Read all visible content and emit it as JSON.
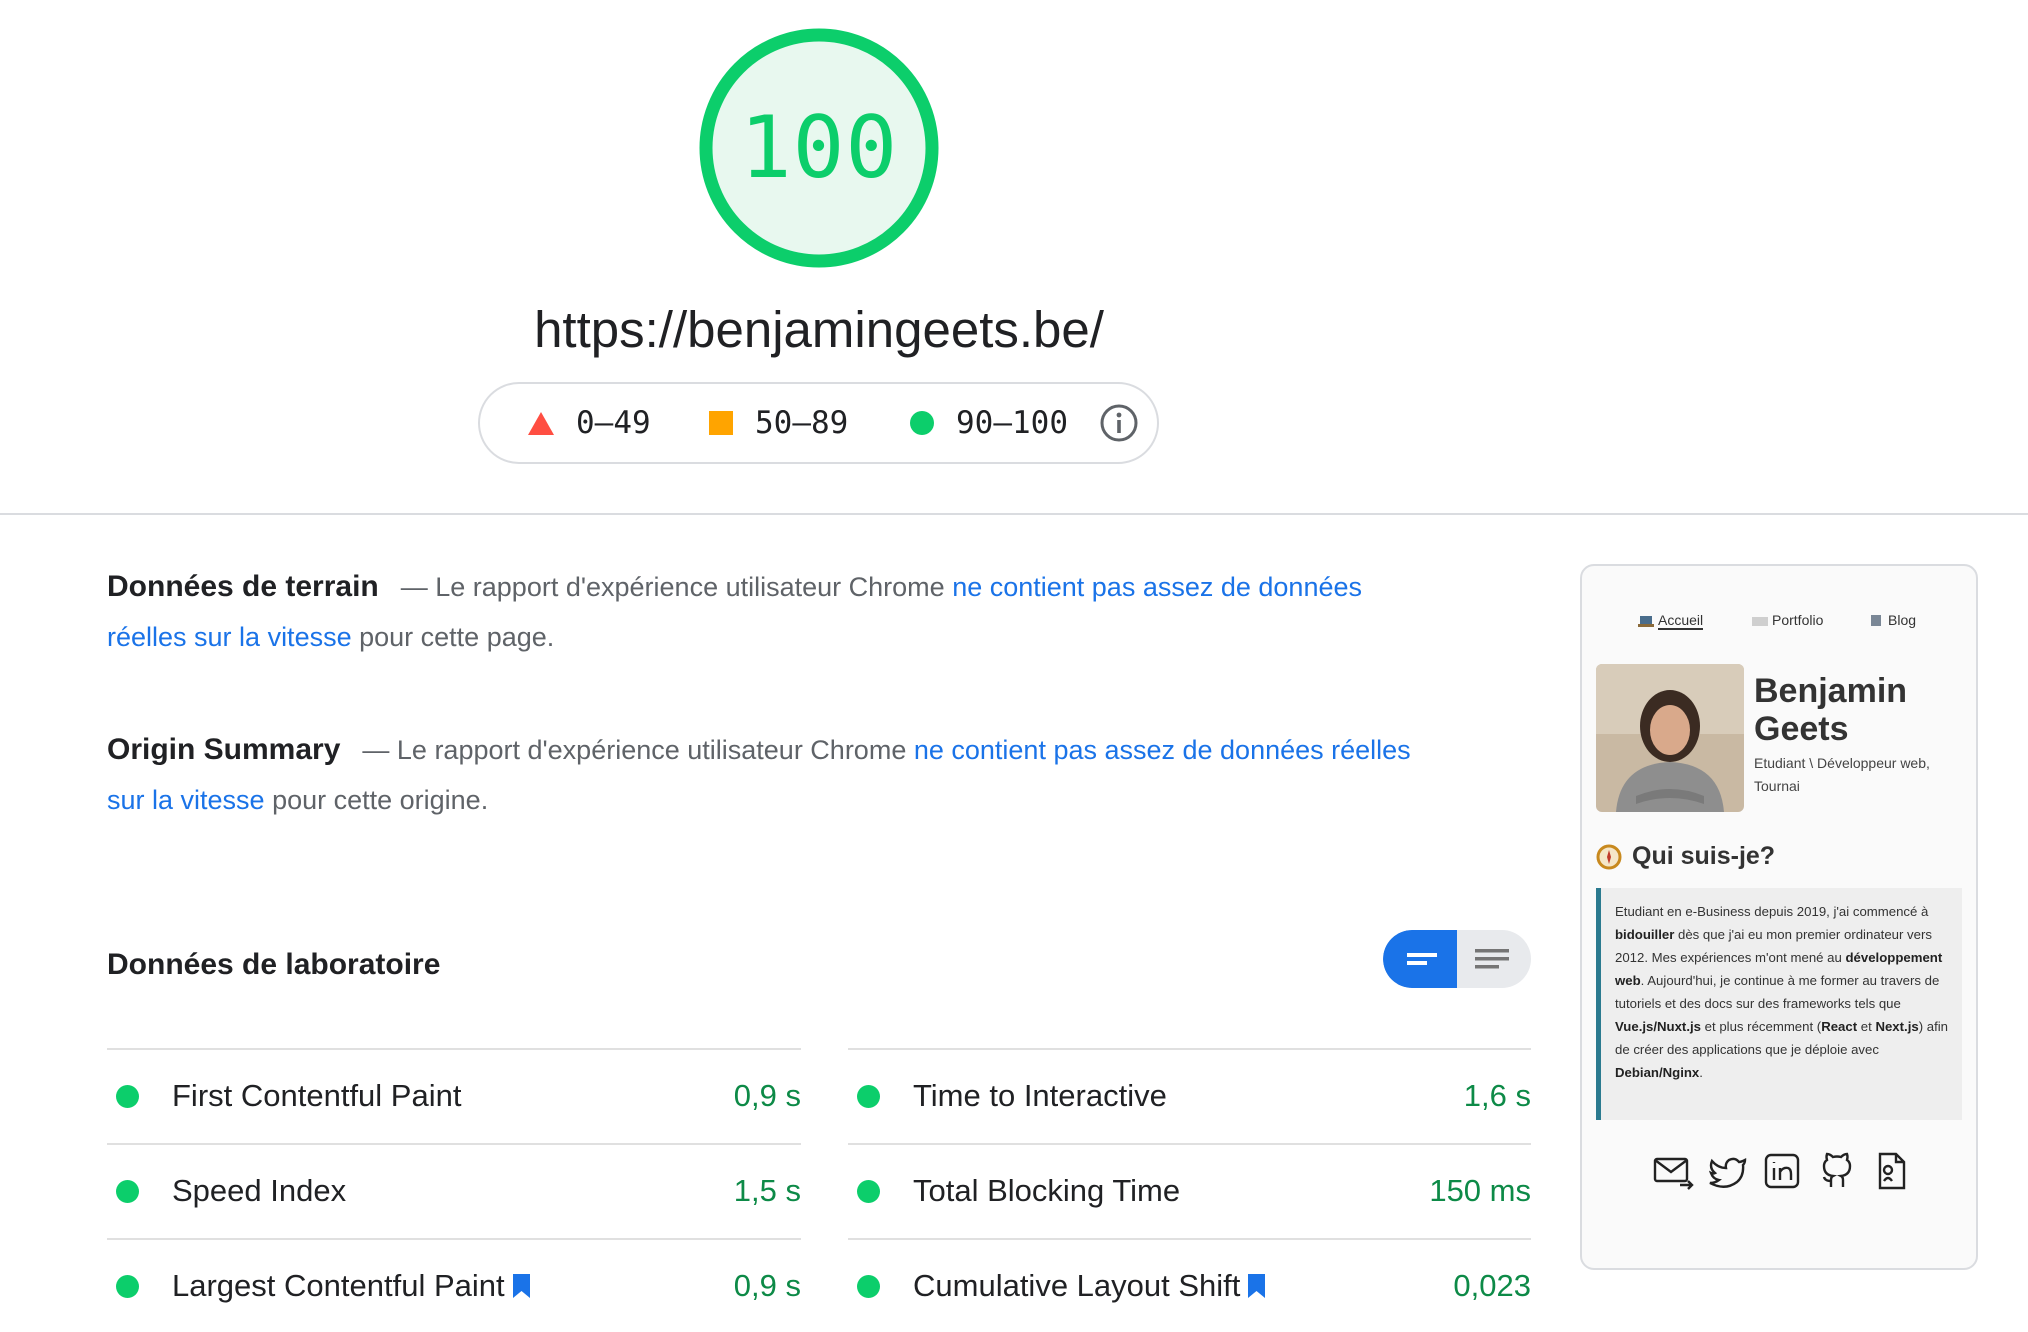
{
  "score": {
    "value": "100",
    "color": "#0cce6b",
    "fill": "#e8f8ef",
    "url": "https://benjamingeets.be/"
  },
  "legend": {
    "fail": "0–49",
    "average": "50–89",
    "pass": "90–100",
    "colors": {
      "fail": "#ff4e42",
      "average": "#ffa400",
      "pass": "#0cce6b"
    },
    "info_icon": "info-icon"
  },
  "field": {
    "title": "Données de terrain",
    "dash_text": "— Le rapport d'expérience utilisateur Chrome ",
    "link_text": "ne contient pas assez de données réelles sur la vitesse",
    "tail_text": " pour cette page."
  },
  "origin": {
    "title": "Origin Summary",
    "dash_text": "— Le rapport d'expérience utilisateur Chrome ",
    "link_text": "ne contient pas assez de données réelles sur la vitesse",
    "tail_text": " pour cette origine."
  },
  "lab": {
    "title": "Données de laboratoire",
    "toggle": {
      "active": "compact-view",
      "icons": [
        "compact-view-icon",
        "list-view-icon"
      ]
    },
    "metrics_left": [
      {
        "name": "First Contentful Paint",
        "value": "0,9 s",
        "lcp_badge": false
      },
      {
        "name": "Speed Index",
        "value": "1,5 s",
        "lcp_badge": false
      },
      {
        "name": "Largest Contentful Paint",
        "value": "0,9 s",
        "lcp_badge": true
      }
    ],
    "metrics_right": [
      {
        "name": "Time to Interactive",
        "value": "1,6 s",
        "lcp_badge": false
      },
      {
        "name": "Total Blocking Time",
        "value": "150 ms",
        "lcp_badge": false
      },
      {
        "name": "Cumulative Layout Shift",
        "value": "0,023",
        "lcp_badge": true
      }
    ]
  },
  "screenshot": {
    "nav": [
      "Accueil",
      "Portfolio",
      "Blog"
    ],
    "name_line1": "Benjamin",
    "name_line2": "Geets",
    "subtitle": "Etudiant \\ Développeur web, Tournai",
    "heading": "Qui suis-je?",
    "bio_parts": [
      "Etudiant en e-Business depuis 2019, j'ai commencé à ",
      "bidouiller",
      " dès que j'ai eu mon premier ordinateur vers 2012. Mes expériences m'ont mené au ",
      "développement web",
      ". Aujourd'hui, je continue à me former au travers de tutoriels et des docs sur des frameworks tels que ",
      "Vue.js/Nuxt.js",
      " et plus récemment (",
      "React",
      " et ",
      "Next.js",
      ") afin de créer des applications que je déploie avec ",
      "Debian/Nginx",
      "."
    ],
    "social_icons": [
      "mail-icon",
      "twitter-icon",
      "linkedin-icon",
      "github-icon",
      "cv-icon"
    ]
  }
}
